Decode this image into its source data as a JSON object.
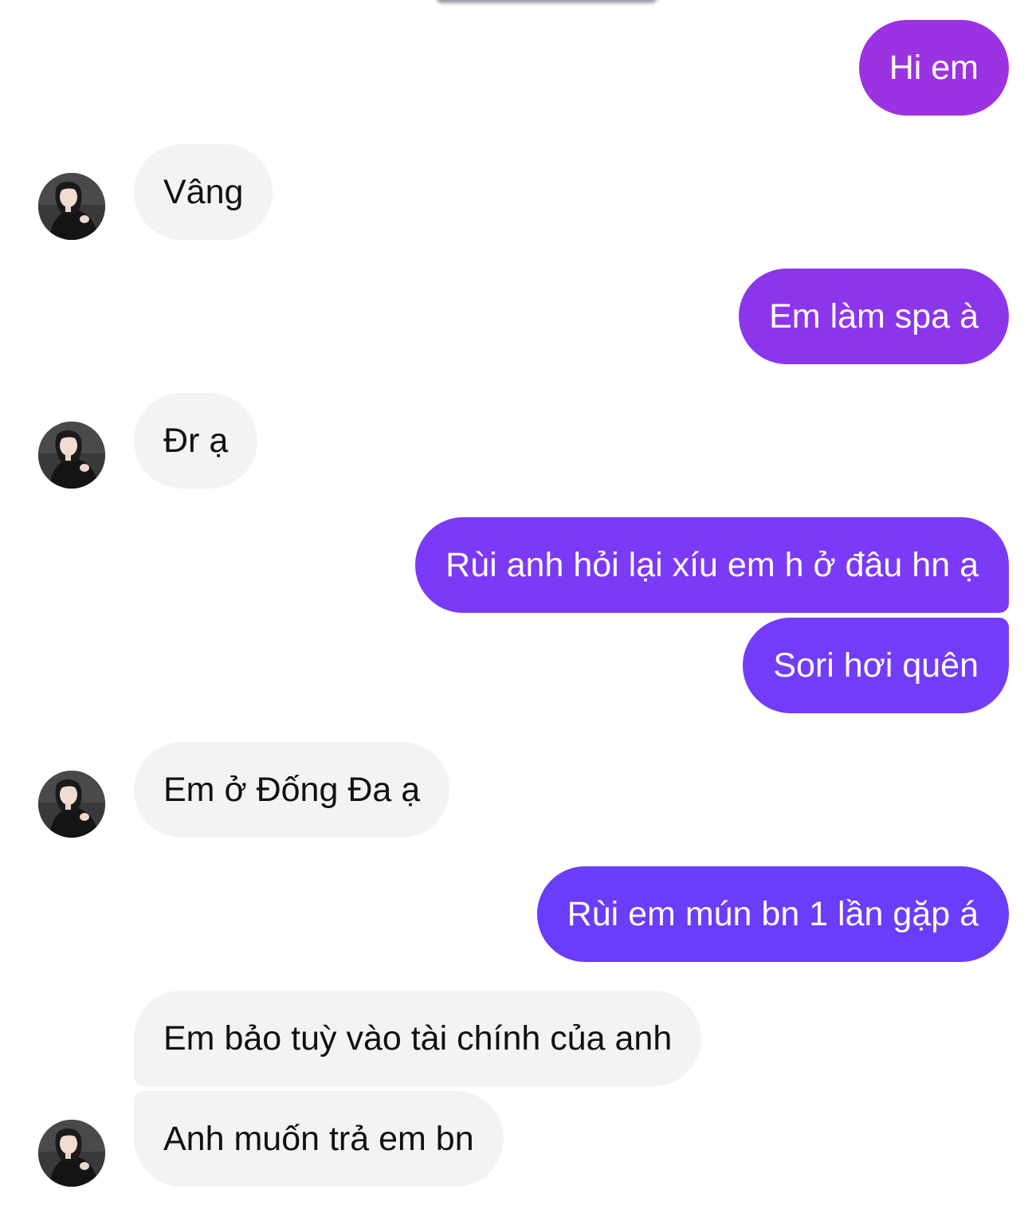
{
  "conversation": {
    "sent_gradient": [
      "#a033e0",
      "#6b3cfa"
    ],
    "incoming_bubble_color": "#f2f3f5",
    "avatar_icon": "contact-avatar-photo",
    "messages": [
      {
        "from": "me",
        "text": "Hi em"
      },
      {
        "from": "contact",
        "text": "Vâng"
      },
      {
        "from": "me",
        "text": "Em làm spa à"
      },
      {
        "from": "contact",
        "text": "Đr ạ"
      },
      {
        "from": "me",
        "text": "Rùi anh hỏi lại xíu em h ở đâu hn ạ"
      },
      {
        "from": "me",
        "text": "Sori hơi quên"
      },
      {
        "from": "contact",
        "text": "Em ở Đống Đa ạ"
      },
      {
        "from": "me",
        "text": "Rùi em mún bn 1 lần gặp á"
      },
      {
        "from": "contact",
        "text": "Em bảo tuỳ vào tài chính của anh"
      },
      {
        "from": "contact",
        "text": "Anh muốn trả em bn"
      }
    ]
  }
}
